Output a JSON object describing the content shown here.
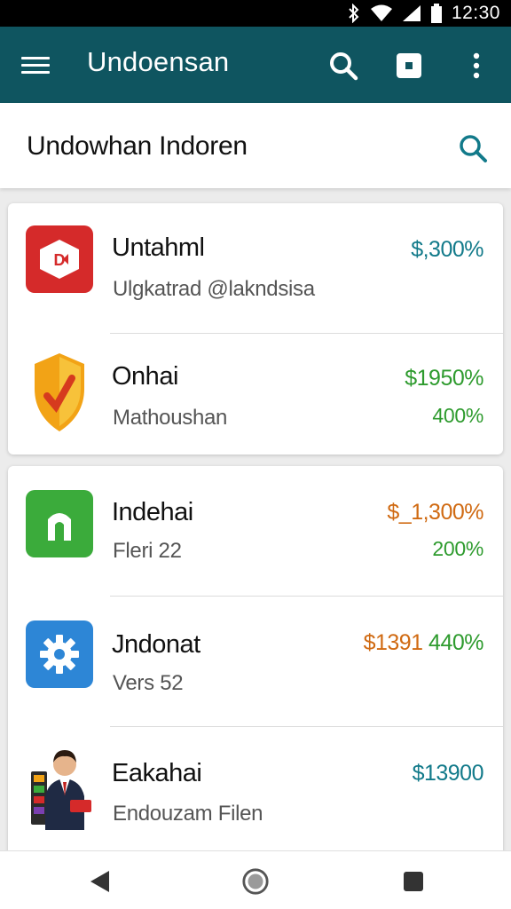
{
  "status_bar": {
    "time": "12:30",
    "icons": [
      "bluetooth-icon",
      "wifi-icon",
      "signal-icon",
      "battery-icon"
    ]
  },
  "app_bar": {
    "title": "Undoensan",
    "actions": [
      "search-icon",
      "square-icon",
      "more-vert-icon"
    ],
    "color": "#0f5560"
  },
  "search": {
    "text": "Undowhan Indoren",
    "icon": "search-icon"
  },
  "lists": {
    "card1": [
      {
        "name": "Untahml",
        "subtitle": "Ulgkatrad @lakndsisa",
        "value": "$,300%",
        "value_color": "#127a8a",
        "icon": "media-app-icon",
        "icon_color": "#d52a2a"
      },
      {
        "name": "Onhai",
        "subtitle": "Mathoushan",
        "value": "$1950%",
        "secondary_value": "400%",
        "value_color": "#2e9b2e",
        "icon": "shield-icon",
        "icon_color": "#f2a316"
      }
    ],
    "card2": [
      {
        "name": "Indehai",
        "subtitle": "Fleri 22",
        "value": "$_1,300%",
        "secondary_value": "200%",
        "value_color": "#d06a12",
        "secondary_color": "#2e9b2e",
        "icon": "home-app-icon",
        "icon_color": "#3bab3b"
      },
      {
        "name": "Jndonat",
        "subtitle": "Vers 52",
        "value": "$1391",
        "value_extra": "440%",
        "value_color": "#d06a12",
        "extra_color": "#2e9b2e",
        "icon": "settings-gear-icon",
        "icon_color": "#2d86d6"
      },
      {
        "name": "Eakahai",
        "subtitle": "Endouzam Filen",
        "value": "$13900",
        "value_color": "#127a8a",
        "icon": "businessman-icon"
      }
    ]
  },
  "nav_bar": {
    "buttons": [
      "back-icon",
      "home-icon",
      "recents-icon"
    ]
  }
}
